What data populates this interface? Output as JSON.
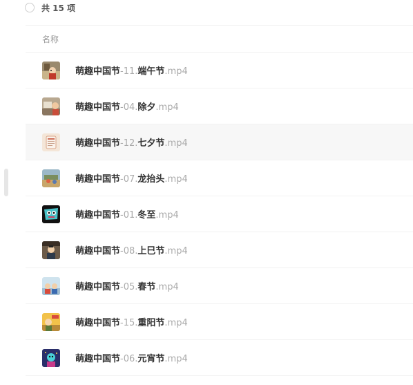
{
  "summary": {
    "count_text": "共 15 项"
  },
  "list": {
    "column_header": "名称",
    "items": [
      {
        "series": "萌趣中国节",
        "sep": "-11.",
        "title": "端午节",
        "ext": ".mp4",
        "icon": "cartoon-thumbnail-icon",
        "active": false
      },
      {
        "series": "萌趣中国节",
        "sep": "-04.",
        "title": "除夕",
        "ext": ".mp4",
        "icon": "cartoon-thumbnail-icon",
        "active": false
      },
      {
        "series": "萌趣中国节",
        "sep": "-12.",
        "title": "七夕节",
        "ext": ".mp4",
        "icon": "cartoon-thumbnail-icon",
        "active": true
      },
      {
        "series": "萌趣中国节",
        "sep": "-07.",
        "title": "龙抬头",
        "ext": ".mp4",
        "icon": "cartoon-thumbnail-icon",
        "active": false
      },
      {
        "series": "萌趣中国节",
        "sep": "-01.",
        "title": "冬至",
        "ext": ".mp4",
        "icon": "cartoon-thumbnail-icon",
        "active": false
      },
      {
        "series": "萌趣中国节",
        "sep": "-08.",
        "title": "上巳节",
        "ext": ".mp4",
        "icon": "cartoon-thumbnail-icon",
        "active": false
      },
      {
        "series": "萌趣中国节",
        "sep": "-05.",
        "title": "春节",
        "ext": ".mp4",
        "icon": "cartoon-thumbnail-icon",
        "active": false
      },
      {
        "series": "萌趣中国节",
        "sep": "-15.",
        "title": "重阳节",
        "ext": ".mp4",
        "icon": "cartoon-thumbnail-icon",
        "active": false
      },
      {
        "series": "萌趣中国节",
        "sep": "-06.",
        "title": "元宵节",
        "ext": ".mp4",
        "icon": "cartoon-thumbnail-icon",
        "active": false
      }
    ]
  },
  "colors": {
    "active_row_bg": "#f7f7f7",
    "muted_text": "#aaaaaa",
    "primary_text": "#333333"
  }
}
